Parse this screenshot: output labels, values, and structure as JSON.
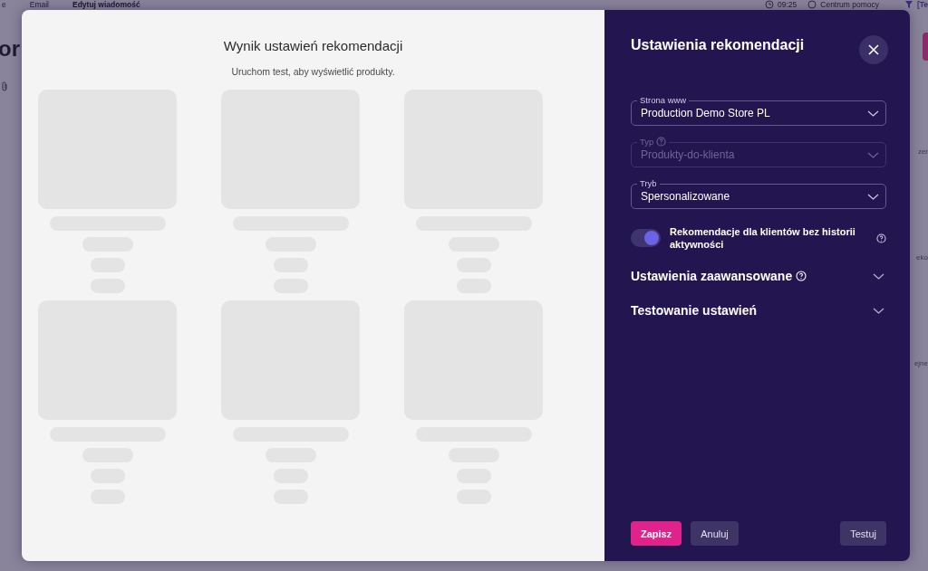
{
  "background": {
    "topbar": {
      "crumbs": [
        "e",
        "Email",
        "Edytuj wiadomość"
      ],
      "time": "09:25",
      "help": "Centrum pomocy",
      "user": "[Te"
    },
    "heading": "or",
    "side_fragments": [
      "zer",
      "eko",
      "ejne"
    ]
  },
  "preview": {
    "title": "Wynik ustawień rekomendacji",
    "subtitle": "Uruchom test, aby wyświetlić produkty."
  },
  "settings": {
    "title": "Ustawienia rekomendacji",
    "fields": [
      {
        "label": "Strona www",
        "value": "Production Demo Store PL",
        "disabled": false,
        "help": false
      },
      {
        "label": "Typ",
        "value": "Produkty-do-klienta",
        "disabled": true,
        "help": true
      },
      {
        "label": "Tryb",
        "value": "Spersonalizowane",
        "disabled": false,
        "help": false
      }
    ],
    "toggle": {
      "label": "Rekomendacje dla klientów bez historii aktywności",
      "on": true
    },
    "sections": [
      {
        "title": "Ustawienia zaawansowane",
        "help": true,
        "expanded": false
      },
      {
        "title": "Testowanie ustawień",
        "help": false,
        "expanded": false
      }
    ],
    "buttons": [
      {
        "label": "Zapisz",
        "kind": "primary"
      },
      {
        "label": "Anuluj",
        "kind": "secondary"
      },
      {
        "label": "Testuj",
        "kind": "secondary"
      }
    ]
  }
}
